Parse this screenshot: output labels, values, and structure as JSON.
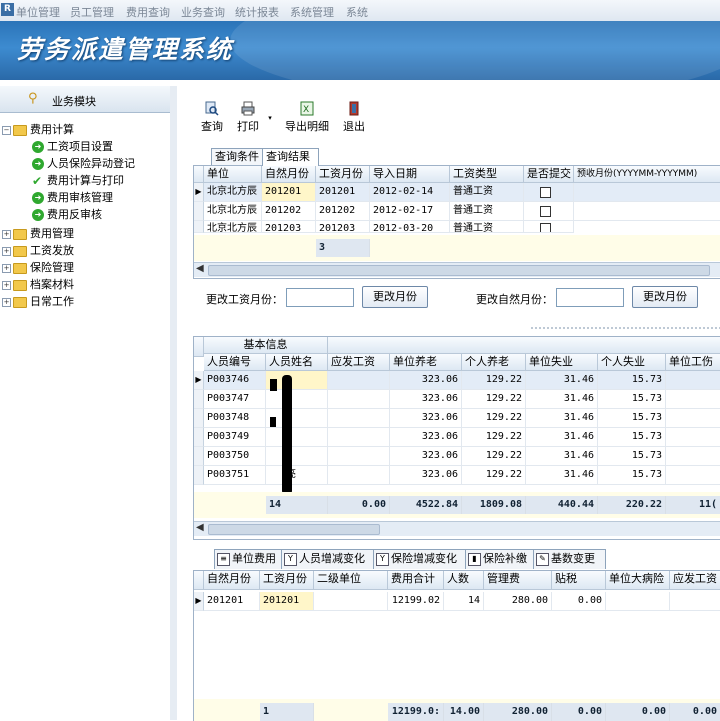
{
  "menu": [
    "单位管理",
    "员工管理",
    "费用查询",
    "业务查询",
    "统计报表",
    "系统管理",
    "系统"
  ],
  "app_title": "劳务派遣管理系统",
  "sidebar": {
    "header": "业务模块",
    "tree": [
      {
        "label": "费用计算",
        "expanded": true,
        "children": [
          "工资项目设置",
          "人员保险异动登记",
          "费用计算与打印",
          "费用审核管理",
          "费用反审核"
        ]
      },
      {
        "label": "费用管理"
      },
      {
        "label": "工资发放"
      },
      {
        "label": "保险管理"
      },
      {
        "label": "档案材料"
      },
      {
        "label": "日常工作"
      }
    ]
  },
  "toolbar": {
    "query": "查询",
    "print": "打印",
    "export": "导出明细",
    "exit": "退出"
  },
  "top_tabs": [
    "查询条件",
    "查询结果"
  ],
  "grid1": {
    "columns": [
      "单位",
      "自然月份",
      "工资月份",
      "导入日期",
      "工资类型",
      "是否提交",
      "预收月份(YYYYMM-YYYYMM)"
    ],
    "rows": [
      [
        "北京北方辰",
        "201201",
        "201201",
        "2012-02-14",
        "普通工资"
      ],
      [
        "北京北方辰",
        "201202",
        "201202",
        "2012-02-17",
        "普通工资"
      ],
      [
        "北京北方辰",
        "201203",
        "201203",
        "2012-03-20",
        "普通工资"
      ]
    ],
    "summary_count": "3"
  },
  "change_row": {
    "salary_month_label": "更改工资月份：",
    "salary_month_button": "更改月份",
    "natural_month_label": "更改自然月份：",
    "natural_month_button": "更改月份"
  },
  "grid2": {
    "band": "基本信息",
    "columns": [
      "人员编号",
      "人员姓名",
      "应发工资",
      "单位养老",
      "个人养老",
      "单位失业",
      "个人失业",
      "单位工伤"
    ],
    "rows": [
      [
        "P003746",
        "",
        "",
        "323.06",
        "129.22",
        "31.46",
        "15.73"
      ],
      [
        "P003747",
        "",
        "",
        "323.06",
        "129.22",
        "31.46",
        "15.73"
      ],
      [
        "P003748",
        "",
        "",
        "323.06",
        "129.22",
        "31.46",
        "15.73"
      ],
      [
        "P003749",
        "",
        "",
        "323.06",
        "129.22",
        "31.46",
        "15.73"
      ],
      [
        "P003750",
        "",
        "",
        "323.06",
        "129.22",
        "31.46",
        "15.73"
      ],
      [
        "P003751",
        "亮",
        "",
        "323.06",
        "129.22",
        "31.46",
        "15.73"
      ]
    ],
    "summary": [
      "14",
      "0.00",
      "4522.84",
      "1809.08",
      "440.44",
      "220.22",
      "11("
    ]
  },
  "bottom_tabs": [
    "单位费用",
    "人员增减变化",
    "保险增减变化",
    "保险补缴",
    "基数变更"
  ],
  "grid3": {
    "columns": [
      "自然月份",
      "工资月份",
      "二级单位",
      "费用合计",
      "人数",
      "管理费",
      "贴税",
      "单位大病险",
      "应发工资"
    ],
    "rows": [
      [
        "201201",
        "201201",
        "",
        "12199.02",
        "14",
        "280.00",
        "0.00"
      ]
    ],
    "summary": [
      "1",
      "12199.0:",
      "14.00",
      "280.00",
      "0.00",
      "0.00",
      "0.00"
    ]
  }
}
